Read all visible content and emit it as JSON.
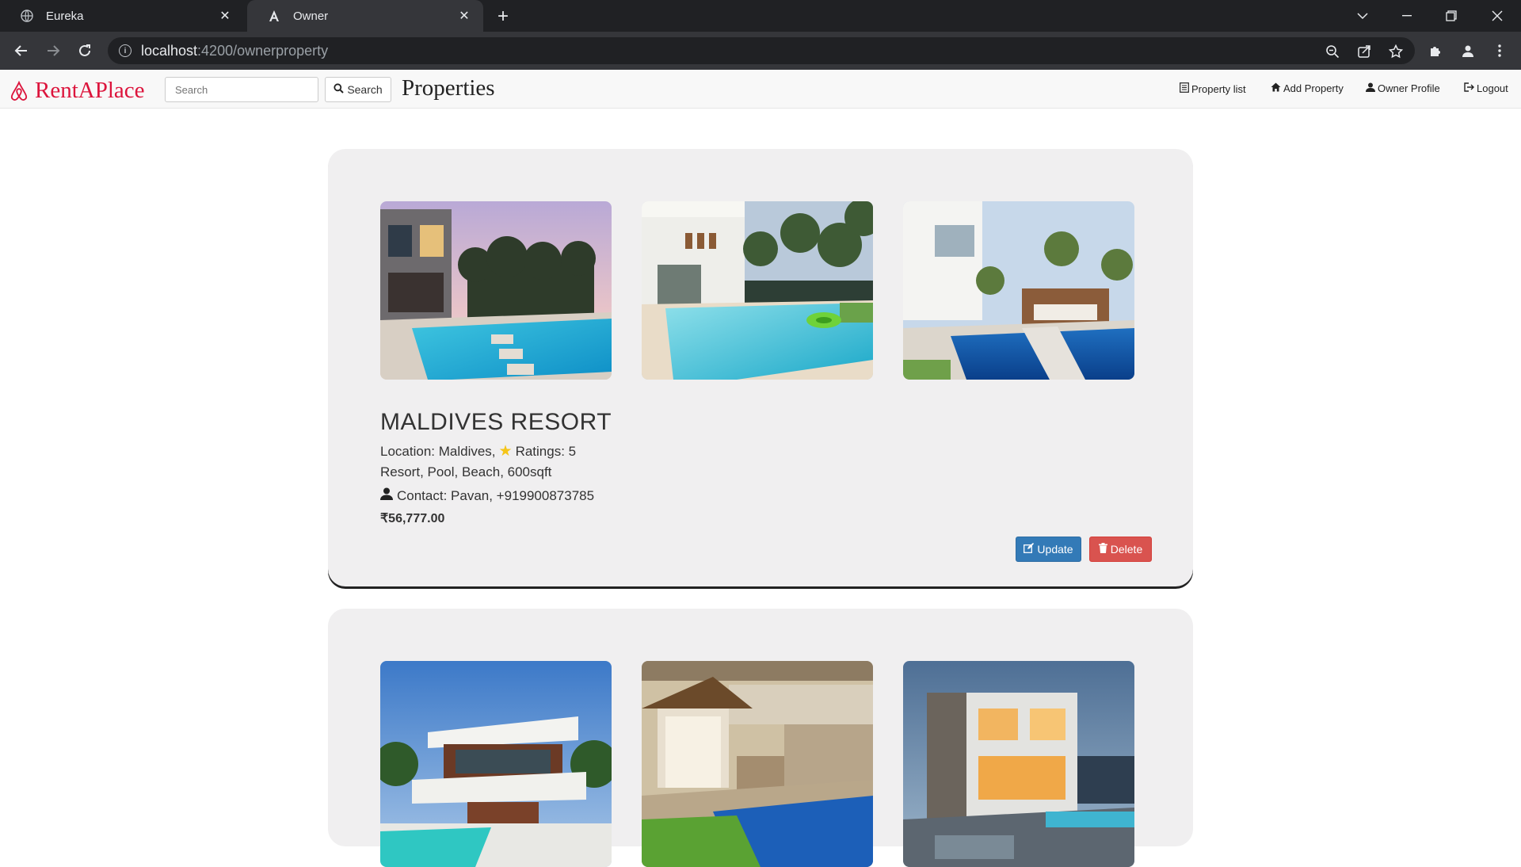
{
  "browser": {
    "tabs": [
      {
        "title": "Eureka",
        "active": false
      },
      {
        "title": "Owner",
        "active": true
      }
    ],
    "url_host": "localhost",
    "url_path": ":4200/ownerproperty"
  },
  "navbar": {
    "brand": "RentAPlace",
    "search_placeholder": "Search",
    "search_button": "Search",
    "page_title": "Properties",
    "links": [
      "Property list",
      "Add Property",
      "Owner Profile",
      "Logout"
    ]
  },
  "properties": [
    {
      "name": "MALDIVES RESORT",
      "location_prefix": "Location: Maldives,",
      "ratings": "Ratings: 5",
      "features": "Resort, Pool, Beach, 600sqft",
      "contact": "Contact: Pavan, +919900873785",
      "price": "₹56,777.00",
      "update_label": "Update",
      "delete_label": "Delete"
    }
  ],
  "colors": {
    "brand": "#dc143c",
    "update": "#337ab7",
    "delete": "#d9534f",
    "card_bg": "#f0eff0"
  }
}
